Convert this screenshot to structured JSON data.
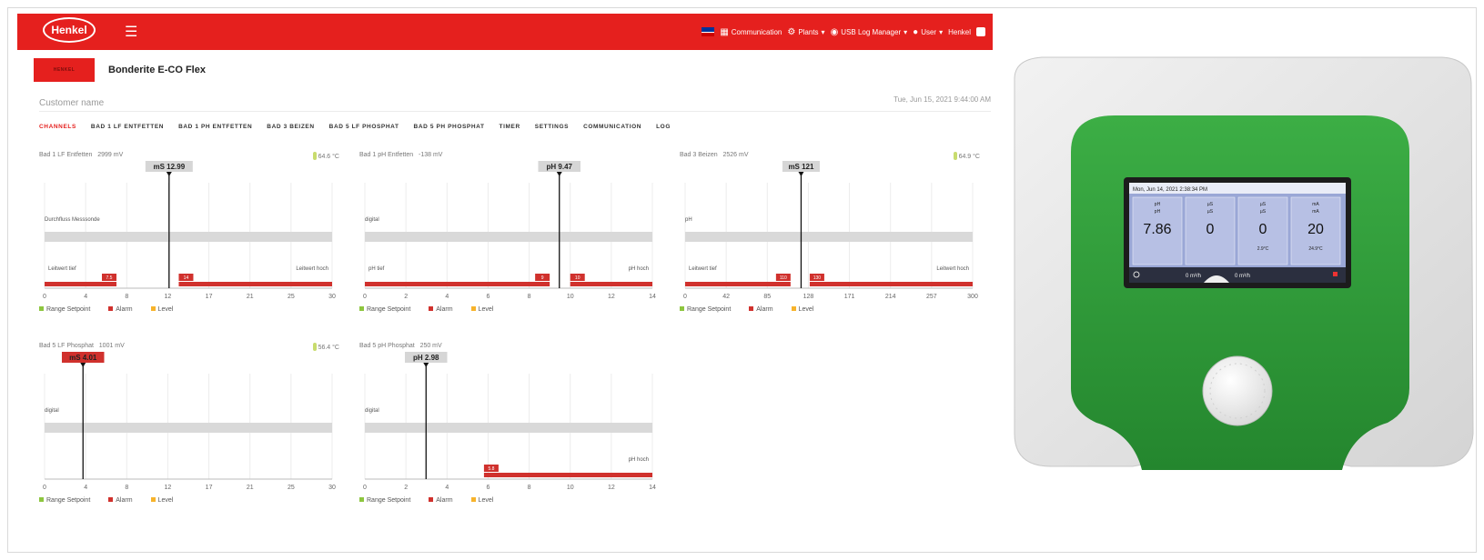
{
  "header": {
    "logo": "Henkel",
    "nav": {
      "communication": "Communication",
      "plants": "Plants",
      "usb": "USB Log Manager",
      "user": "User",
      "henkel": "Henkel"
    }
  },
  "brand": {
    "badge": "HENKEL",
    "product": "Bonderite E-CO Flex"
  },
  "customer": {
    "name": "Customer name",
    "datetime": "Tue, Jun 15, 2021 9:44:00 AM"
  },
  "tabs": [
    "CHANNELS",
    "BAD 1 LF ENTFETTEN",
    "BAD 1 PH ENTFETTEN",
    "BAD 3 BEIZEN",
    "BAD 5 LF PHOSPHAT",
    "BAD 5 PH PHOSPHAT",
    "TIMER",
    "SETTINGS",
    "COMMUNICATION",
    "LOG"
  ],
  "legend": {
    "range": "Range Setpoint",
    "alarm": "Alarm",
    "level": "Level"
  },
  "colors": {
    "brand_red": "#e5201e",
    "range": "#8dc63f",
    "alarm": "#d0312d",
    "level": "#f7b32b",
    "device_green": "#2e9e3a"
  },
  "panels": [
    {
      "name": "Bad 1 LF Entfetten",
      "mv": "2999 mV",
      "temp": "64.6 °C",
      "value": "mS 12.99",
      "value_num": 12.99,
      "value_alarm": false,
      "ticks": [
        "0",
        "4",
        "8",
        "12",
        "17",
        "21",
        "25",
        "30"
      ],
      "xmax": 30,
      "sensor_label": "Durchfluss Messsonde",
      "low_label": "Leitwert tief",
      "high_label": "Leitwert hoch",
      "alarm_low_label": "7.5",
      "alarm_low": 7.5,
      "alarm_high_label": "14",
      "alarm_high": 14
    },
    {
      "name": "Bad 1 pH Entfetten",
      "mv": "-138 mV",
      "temp": "",
      "value": "pH 9.47",
      "value_num": 9.47,
      "value_alarm": false,
      "ticks": [
        "0",
        "2",
        "4",
        "6",
        "8",
        "10",
        "12",
        "14"
      ],
      "xmax": 14,
      "sensor_label": "digital",
      "low_label": "pH tief",
      "high_label": "pH hoch",
      "alarm_low_label": "9",
      "alarm_low": 9,
      "alarm_high_label": "10",
      "alarm_high": 10
    },
    {
      "name": "Bad 3 Beizen",
      "mv": "2526 mV",
      "temp": "64.9 °C",
      "value": "mS 121",
      "value_num": 121,
      "value_alarm": false,
      "ticks": [
        "0",
        "42",
        "85",
        "128",
        "171",
        "214",
        "257",
        "300"
      ],
      "xmax": 300,
      "sensor_label": "pH",
      "low_label": "Leitwert tief",
      "high_label": "Leitwert hoch",
      "alarm_low_label": "110",
      "alarm_low": 110,
      "alarm_high_label": "130",
      "alarm_high": 130
    },
    {
      "name": "Bad 5 LF Phosphat",
      "mv": "1001 mV",
      "temp": "56.4 °C",
      "value": "mS 4.01",
      "value_num": 4.01,
      "value_alarm": true,
      "ticks": [
        "0",
        "4",
        "8",
        "12",
        "17",
        "21",
        "25",
        "30"
      ],
      "xmax": 30,
      "sensor_label": "digital",
      "low_label": "",
      "high_label": ""
    },
    {
      "name": "Bad 5 pH Phosphat",
      "mv": "250 mV",
      "temp": "",
      "value": "pH 2.98",
      "value_num": 2.98,
      "value_alarm": false,
      "ticks": [
        "0",
        "2",
        "4",
        "6",
        "8",
        "10",
        "12",
        "14"
      ],
      "xmax": 14,
      "sensor_label": "digital",
      "low_label": "",
      "high_label": "pH hoch",
      "alarm_high_label": "5.8",
      "alarm_high": 5.8
    }
  ],
  "device": {
    "datetime": "Mon, Jun 14, 2021 2:38:34 PM",
    "cols": [
      {
        "unit": "pH",
        "sub": "pH",
        "value": "7.86",
        "extra": ""
      },
      {
        "unit": "µS",
        "sub": "µS",
        "value": "0",
        "extra": ""
      },
      {
        "unit": "µS",
        "sub": "µS",
        "value": "0",
        "extra": "2.9°C"
      },
      {
        "unit": "mA",
        "sub": "mA",
        "value": "20",
        "extra": "24.9°C"
      }
    ],
    "flow1": "0 m³/h",
    "flow2": "0 m³/h"
  }
}
